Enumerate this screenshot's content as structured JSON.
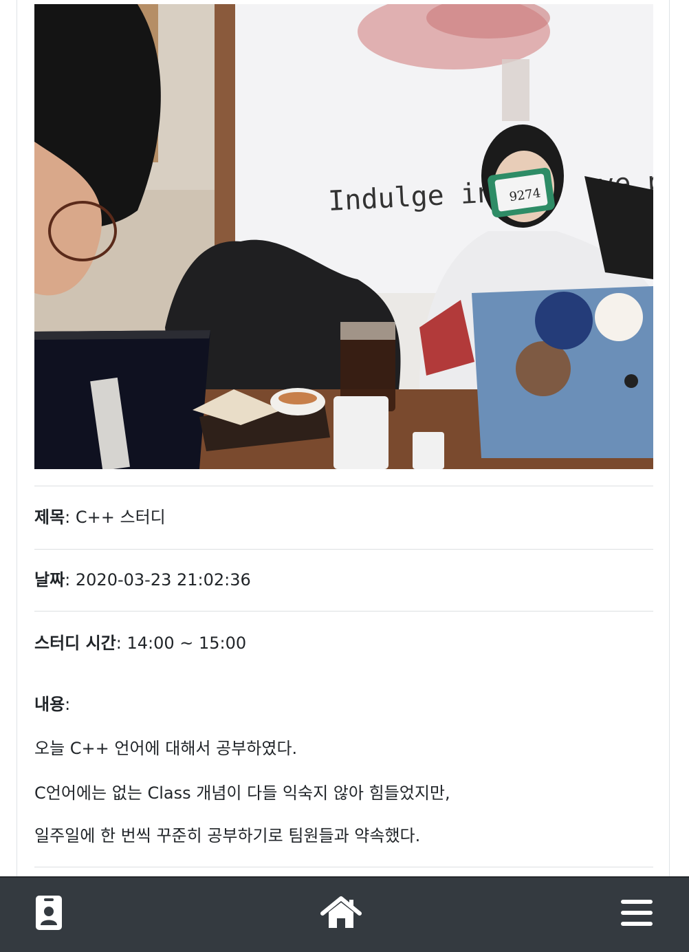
{
  "post": {
    "title_label": "제목",
    "title_value": "C++ 스터디",
    "date_label": "날짜",
    "date_value": "2020-03-23 21:02:36",
    "time_label": "스터디 시간",
    "time_value": "14:00 ~ 15:00",
    "content_label": "내용",
    "content_lines": [
      "오늘 C++ 언어에 대해서 공부하였다.",
      "C언어에는 없는 Class 개념이 다들 익숙지 않아 힘들었지만,",
      "일주일에 한 번씩 꾸준히 공부하기로 팀원들과 약속했다."
    ]
  },
  "photo": {
    "wall_text": "Indulge in",
    "wall_text_tail": "ve p",
    "phone_number": "9274"
  },
  "navbar": {
    "left_icon": "id-badge-icon",
    "center_icon": "home-icon",
    "right_icon": "menu-icon"
  }
}
